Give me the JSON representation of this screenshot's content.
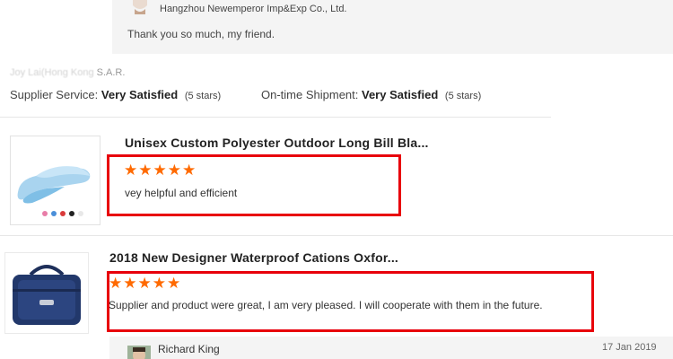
{
  "supplier_reply": {
    "company": "Hangzhou Newemperor Imp&Exp Co., Ltd.",
    "text": "Thank you so much, my friend."
  },
  "buyer": {
    "name_blurred": "Joy Lai(Hong Kong",
    "region": "S.A.R."
  },
  "ratings": {
    "supplier_service_label": "Supplier Service:",
    "supplier_service_value": "Very Satisfied",
    "supplier_service_stars": "(5 stars)",
    "shipment_label": "On-time Shipment:",
    "shipment_value": "Very Satisfied",
    "shipment_stars": "(5 stars)"
  },
  "reviews": [
    {
      "title": "Unisex Custom Polyester Outdoor Long Bill Bla...",
      "stars": "★★★★★",
      "rating": 5,
      "text": "vey helpful and efficient"
    },
    {
      "title": "2018 New Designer Waterproof Cations Oxfor...",
      "stars": "★★★★★",
      "rating": 5,
      "text": "Supplier and product were great, I am very pleased. I will cooperate with them in the future."
    }
  ],
  "reply2": {
    "name": "Richard King",
    "date": "17 Jan 2019"
  },
  "colors": {
    "star": "#ff6a00",
    "highlight_box": "#e8000b",
    "reply_bg": "#f4f4f4"
  }
}
